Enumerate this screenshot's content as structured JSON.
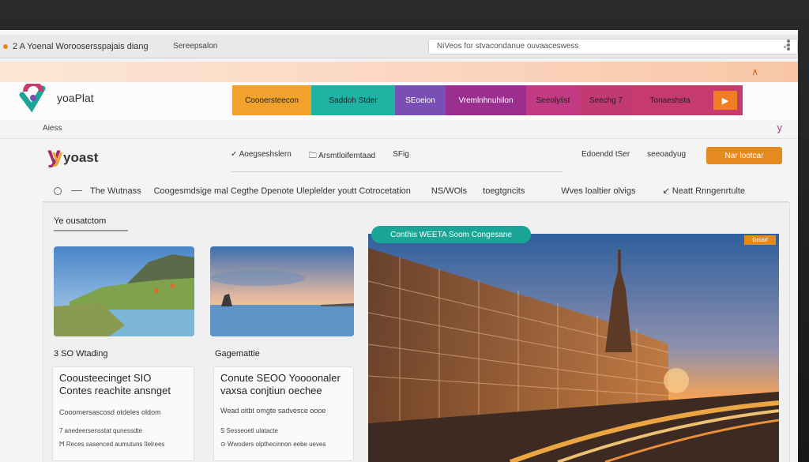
{
  "browser": {
    "tab_title": "2 A Yoenal Woroosersspajais diang",
    "url_text": "Sereepsalon",
    "search_text": "NiVeos for stvacondanue ouvaaceswess",
    "back_glyph": "↙"
  },
  "header": {
    "brand_name": "yoaPlat",
    "categories": [
      {
        "label": "Coooersteecon",
        "color": "#f0a22d"
      },
      {
        "label": "Saddoh Stder",
        "color": "#1fb3a3"
      },
      {
        "label": "SEoeion",
        "color": "#7a4fb3"
      },
      {
        "label": "Vremlnhnuhilon",
        "color": "#9a2f8f"
      },
      {
        "label": "Seeolyiist",
        "color": "#c23a83"
      },
      {
        "label": "Seechg 7",
        "color": "#c13a72"
      },
      {
        "label": "Tonaeshsta",
        "color": "#c63b6e"
      }
    ],
    "play_glyph": "▶",
    "sub_left": "Aiess",
    "sub_right": "y"
  },
  "yoast_nav": {
    "logo_text": "yoast",
    "links": [
      "✓ Aoegseshslern",
      "🗀 Arsmtloifemtaad",
      "SFig"
    ],
    "right_links": [
      "Edoendd tSer",
      "seeoadyug"
    ],
    "cta_label": "Nar lootcar"
  },
  "secondary_nav": {
    "items": [
      "The Wutnass",
      "Coogesmdsige mal Cegthe Dpenote Uleplelder youtt Cotrocetation",
      "NS/WOls",
      "toegtgncits",
      "Wves loaltier olvigs",
      "↙ Neatt Rnngenrtulte"
    ]
  },
  "section": {
    "title": "Ye ousatctom"
  },
  "cards": [
    {
      "title": "3 SO Wtading",
      "heading_1": "Coousteecinget SIO",
      "heading_2": "Contes reachite ansnget",
      "line": "Cooomersascosd otdeles oldom",
      "meta_1": "7 anedeersensstat qunessdte",
      "meta_2": "Ϻ Reces sasenced aumutuns Ilelrees"
    },
    {
      "title": "Gagemattie",
      "heading_1": "Conute SEOO Yoooonaler",
      "heading_2": "vaxsa conjtiun oechee",
      "line": "Wead oitbt omgte sadvesce oooe",
      "meta_1": "Ѕ Sesseoetl ulatacte",
      "meta_2": "⊙ Wwoders olpthecinnon eebe ueves"
    }
  ],
  "feature": {
    "badge": "Conthis WEETA Soom Congesane",
    "tag": "Groarl"
  },
  "colors": {
    "accent_orange": "#e48a1f",
    "teal": "#1aa596",
    "magenta": "#a4286a"
  }
}
